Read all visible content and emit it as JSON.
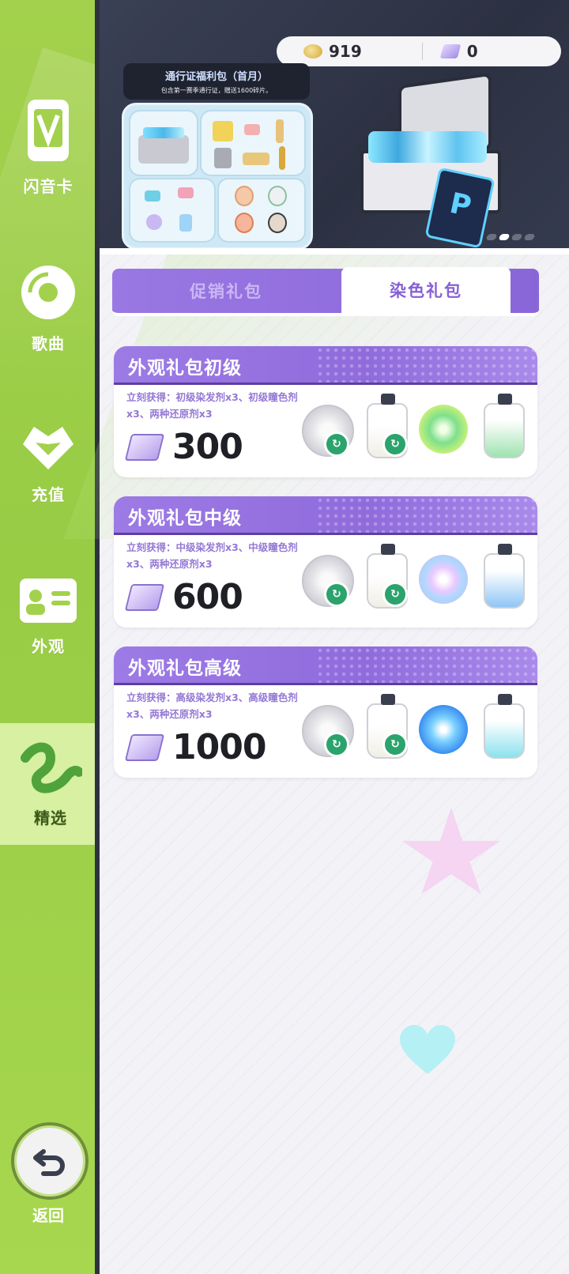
{
  "sidebar": {
    "items": [
      {
        "label": "闪音卡",
        "icon": "music-card-icon"
      },
      {
        "label": "歌曲",
        "icon": "disc-icon"
      },
      {
        "label": "充值",
        "icon": "heart-icon"
      },
      {
        "label": "外观",
        "icon": "profile-card-icon"
      },
      {
        "label": "精选",
        "icon": "wave-icon",
        "active": true
      }
    ],
    "back_label": "返回"
  },
  "currency": {
    "coins": "919",
    "gems": "0"
  },
  "banner": {
    "pass_title": "通行证福利包（首月）",
    "pass_subtitle": "包含第一赛季通行证，赠送1600碎片。",
    "card_letter": "P"
  },
  "tabs": {
    "promo": "促销礼包",
    "dye": "染色礼包",
    "active": "dye"
  },
  "packs": [
    {
      "title": "外观礼包初级",
      "desc": "立刻获得：初级染发剂x3、初级瞳色剂x3、两种还原剂x3",
      "price": "300"
    },
    {
      "title": "外观礼包中级",
      "desc": "立刻获得：中级染发剂x3、中级瞳色剂x3、两种还原剂x3",
      "price": "600"
    },
    {
      "title": "外观礼包高级",
      "desc": "立刻获得：高级染发剂x3、高级瞳色剂x3、两种还原剂x3",
      "price": "1000"
    }
  ],
  "colors": {
    "sidebar_green": "#a3d14d",
    "accent_purple": "#8f6bdc",
    "badge_green": "#2aa36c"
  }
}
